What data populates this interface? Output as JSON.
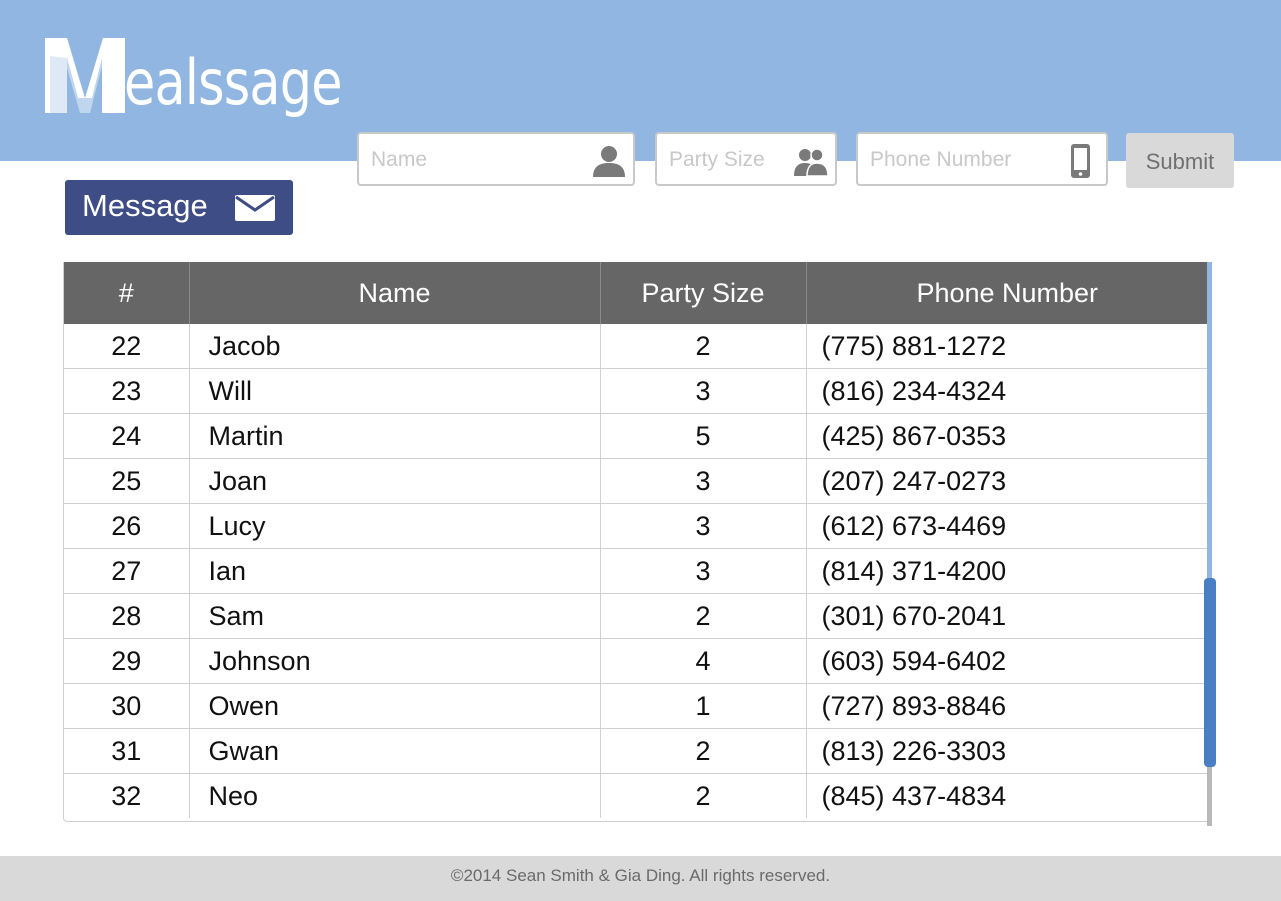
{
  "brand": {
    "logo_text": "ealssage",
    "logo_letter": "M"
  },
  "form": {
    "name_placeholder": "Name",
    "party_placeholder": "Party Size",
    "phone_placeholder": "Phone Number",
    "submit_label": "Submit"
  },
  "message_button": {
    "label": "Message"
  },
  "table": {
    "columns": [
      "#",
      "Name",
      "Party Size",
      "Phone Number"
    ],
    "rows": [
      {
        "num": "22",
        "name": "Jacob",
        "party": "2",
        "phone": "(775) 881-1272"
      },
      {
        "num": "23",
        "name": "Will",
        "party": "3",
        "phone": "(816) 234-4324"
      },
      {
        "num": "24",
        "name": "Martin",
        "party": "5",
        "phone": "(425) 867-0353"
      },
      {
        "num": "25",
        "name": "Joan",
        "party": "3",
        "phone": "(207) 247-0273"
      },
      {
        "num": "26",
        "name": "Lucy",
        "party": "3",
        "phone": "(612) 673-4469"
      },
      {
        "num": "27",
        "name": "Ian",
        "party": "3",
        "phone": "(814) 371-4200"
      },
      {
        "num": "28",
        "name": "Sam",
        "party": "2",
        "phone": "(301) 670-2041"
      },
      {
        "num": "29",
        "name": "Johnson",
        "party": "4",
        "phone": "(603) 594-6402"
      },
      {
        "num": "30",
        "name": "Owen",
        "party": "1",
        "phone": "(727) 893-8846"
      },
      {
        "num": "31",
        "name": "Gwan",
        "party": "2",
        "phone": "(813) 226-3303"
      },
      {
        "num": "32",
        "name": "Neo",
        "party": "2",
        "phone": "(845) 437-4834"
      }
    ]
  },
  "footer": {
    "text": "©2014 Sean Smith & Gia Ding. All rights reserved."
  },
  "icons": {
    "name_field": "user-icon",
    "party_field": "group-icon",
    "phone_field": "mobile-phone-icon",
    "message": "envelope-icon"
  },
  "colors": {
    "header": "#91b6e1",
    "message_button": "#3e4d85",
    "table_header": "#666666",
    "scroll_thumb": "#4a7fc4",
    "footer": "#d9d9d9"
  }
}
